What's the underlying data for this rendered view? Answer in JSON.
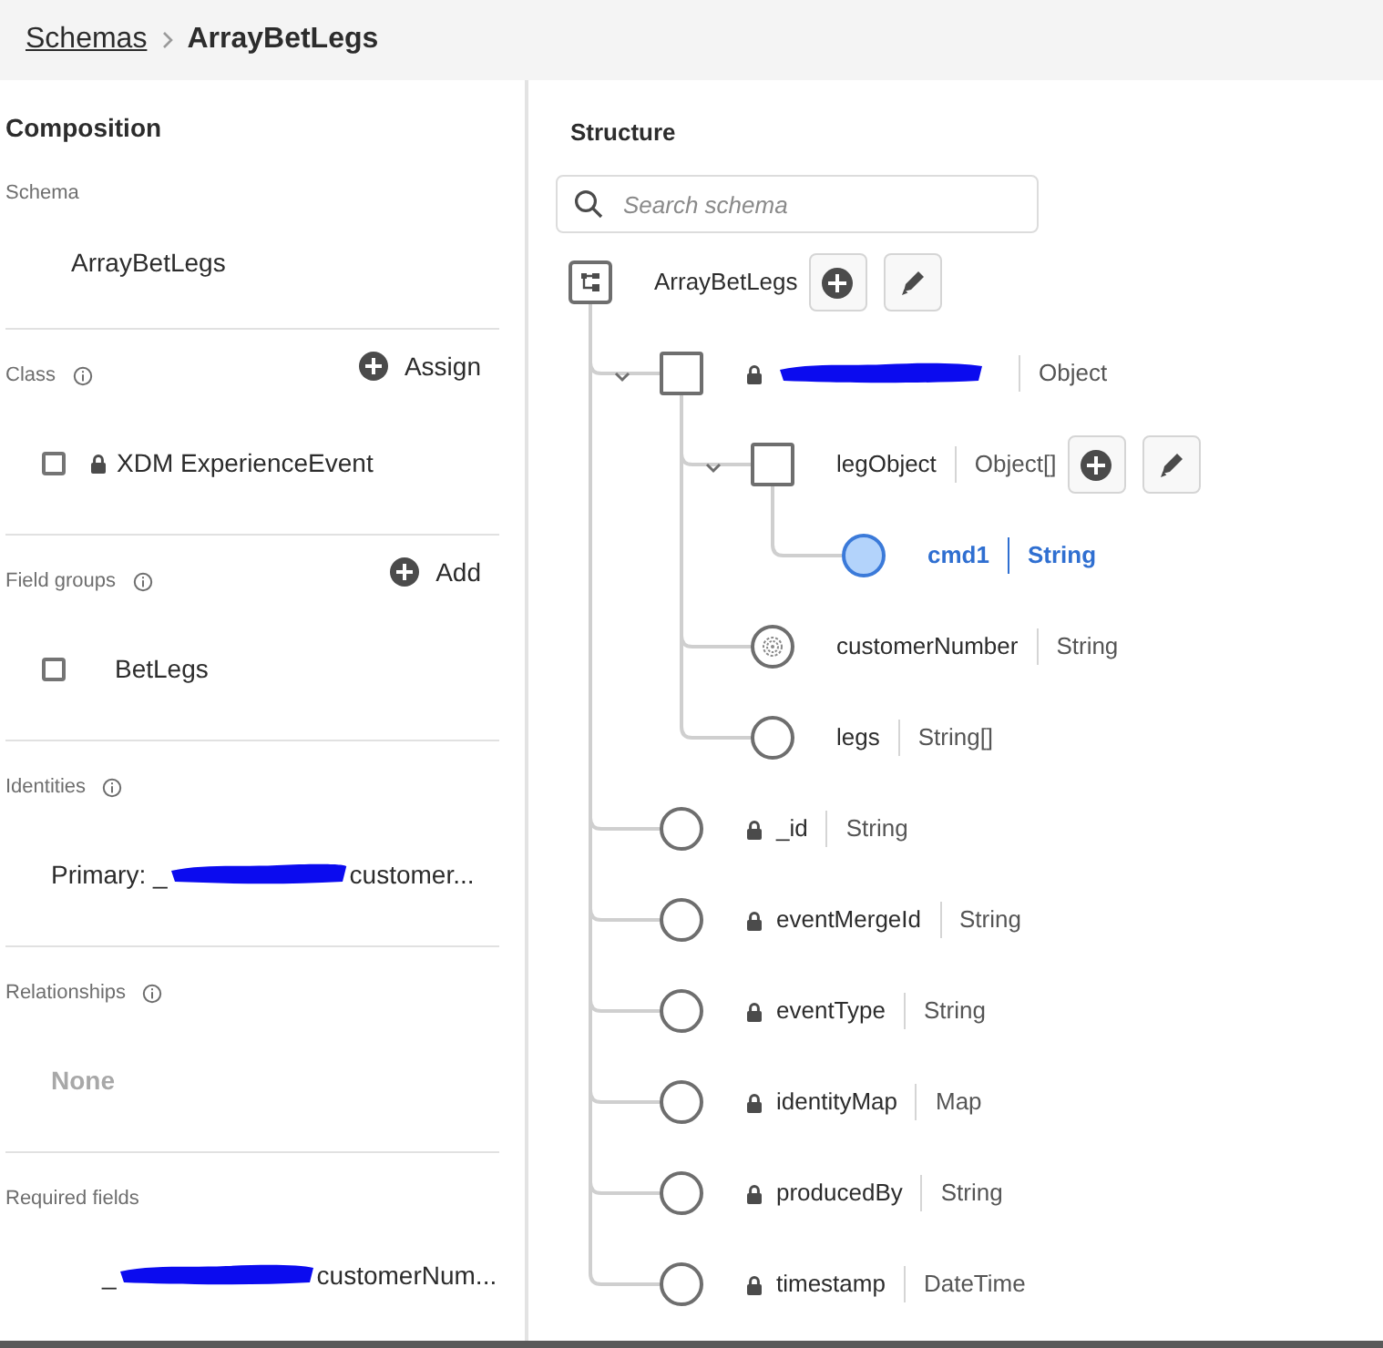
{
  "breadcrumb": [
    {
      "label": "Schemas",
      "link": true
    },
    {
      "label": "ArrayBetLegs",
      "link": false
    }
  ],
  "composition": {
    "title": "Composition",
    "sections": [
      {
        "kind": "schema",
        "label": "Schema",
        "value": "ArrayBetLegs"
      },
      {
        "kind": "class",
        "label": "Class",
        "info": true,
        "action": "Assign",
        "items": [
          {
            "label": "XDM ExperienceEvent",
            "checked": false,
            "locked": true
          }
        ]
      },
      {
        "kind": "fieldgroups",
        "label": "Field groups",
        "info": true,
        "action": "Add",
        "items": [
          {
            "label": "BetLegs",
            "checked": false,
            "locked": false
          }
        ]
      },
      {
        "kind": "redacted",
        "label": "Identities",
        "info": true,
        "text_before": "Primary: _",
        "text_after": "customer..."
      },
      {
        "kind": "empty",
        "label": "Relationships",
        "info": true,
        "value": "None"
      },
      {
        "kind": "redacted",
        "label": "Required fields",
        "info": false,
        "text_before": "_",
        "text_after": "customerNum..."
      }
    ]
  },
  "structure": {
    "title": "Structure",
    "search": {
      "placeholder": "Search schema"
    },
    "tree": [
      {
        "kind": "root",
        "name": "ArrayBetLegs",
        "actions": true,
        "selected": false,
        "children": [
          {
            "kind": "object",
            "redacted": true,
            "type": "Object",
            "locked": true,
            "expanded": true,
            "actions": false,
            "selected": false,
            "children": [
              {
                "kind": "object",
                "redacted": false,
                "name": "legObject",
                "type": "Object[]",
                "locked": false,
                "expanded": true,
                "actions": true,
                "selected": false,
                "children": [
                  {
                    "kind": "field",
                    "redacted": false,
                    "name": "cmd1",
                    "type": "String",
                    "locked": false,
                    "actions": false,
                    "selected": true
                  }
                ]
              },
              {
                "kind": "identity",
                "redacted": false,
                "name": "customerNumber",
                "type": "String",
                "locked": false,
                "actions": false,
                "selected": false
              },
              {
                "kind": "field",
                "redacted": false,
                "name": "legs",
                "type": "String[]",
                "locked": false,
                "actions": false,
                "selected": false
              }
            ]
          },
          {
            "kind": "field",
            "redacted": false,
            "name": "_id",
            "type": "String",
            "locked": true,
            "actions": false,
            "selected": false
          },
          {
            "kind": "field",
            "redacted": false,
            "name": "eventMergeId",
            "type": "String",
            "locked": true,
            "actions": false,
            "selected": false
          },
          {
            "kind": "field",
            "redacted": false,
            "name": "eventType",
            "type": "String",
            "locked": true,
            "actions": false,
            "selected": false
          },
          {
            "kind": "field",
            "redacted": false,
            "name": "identityMap",
            "type": "Map",
            "locked": true,
            "actions": false,
            "selected": false
          },
          {
            "kind": "field",
            "redacted": false,
            "name": "producedBy",
            "type": "String",
            "locked": true,
            "actions": false,
            "selected": false
          },
          {
            "kind": "field",
            "redacted": false,
            "name": "timestamp",
            "type": "DateTime",
            "locked": true,
            "actions": false,
            "selected": false
          }
        ]
      }
    ]
  }
}
